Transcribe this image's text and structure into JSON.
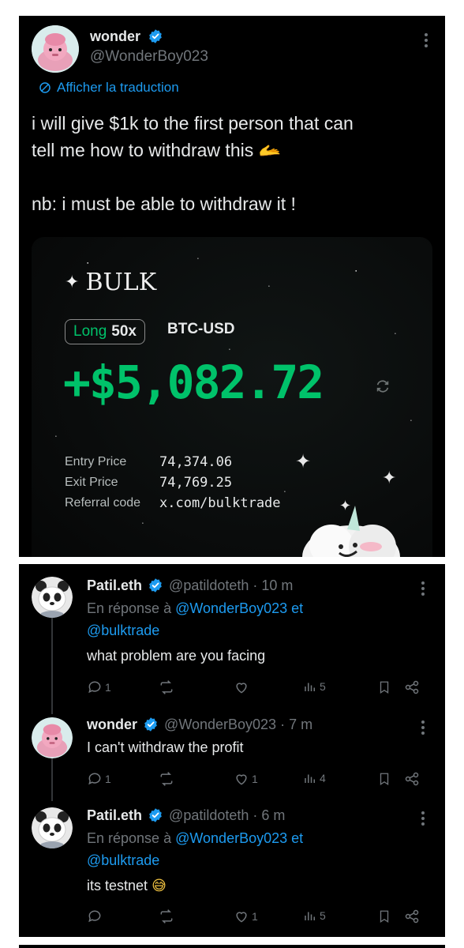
{
  "main_post": {
    "author_name": "wonder",
    "author_handle": "@WonderBoy023",
    "translate_label": "Afficher la traduction",
    "text_line1": "i will give $1k to the first person that can",
    "text_line2": "tell me how to withdraw this",
    "text_emoji": "🫴",
    "text_line3": "nb: i must be able to withdraw it !",
    "card": {
      "logo": "BULK",
      "position_side": "Long",
      "leverage": "50x",
      "pair": "BTC-USD",
      "pnl": "+$5,082.72",
      "entry_label": "Entry Price",
      "entry_value": "74,374.06",
      "exit_label": "Exit Price",
      "exit_value": "74,769.25",
      "referral_label": "Referral code",
      "referral_value": "x.com/bulktrade"
    }
  },
  "replies": [
    {
      "author_name": "Patil.eth",
      "author_handle": "@patildoteth",
      "time": "· 10 m",
      "reply_prefix": "En réponse à",
      "reply_to_1": "@WonderBoy023 et",
      "reply_to_2": "@bulktrade",
      "text": "what problem are you facing",
      "replies_count": "1",
      "likes": "",
      "views": "5"
    },
    {
      "author_name": "wonder",
      "author_handle": "@WonderBoy023",
      "time": "· 7 m",
      "text": "I can't withdraw the profit",
      "replies_count": "1",
      "likes": "1",
      "views": "4"
    },
    {
      "author_name": "Patil.eth",
      "author_handle": "@patildoteth",
      "time": "· 6 m",
      "reply_prefix": "En réponse à",
      "reply_to_1": "@WonderBoy023 et",
      "reply_to_2": "@bulktrade",
      "text": "its testnet",
      "text_emoji": "😅",
      "replies_count": "",
      "likes": "1",
      "views": "5"
    }
  ],
  "colors": {
    "background": "#000000",
    "link": "#1d9bf0",
    "muted": "#71767b",
    "pnl_green": "#00c26a",
    "verified": "#1d9bf0"
  }
}
